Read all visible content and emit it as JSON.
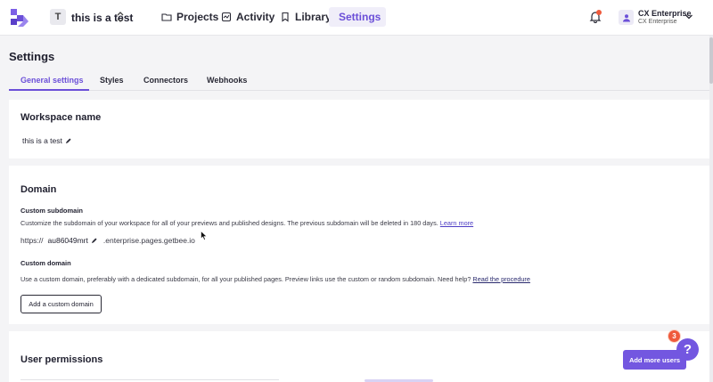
{
  "header": {
    "workspace_initial": "T",
    "workspace_name": "this is a test",
    "nav": [
      {
        "label": "Projects",
        "icon": "folder-icon"
      },
      {
        "label": "Activity",
        "icon": "activity-icon"
      },
      {
        "label": "Library",
        "icon": "bookmark-icon"
      },
      {
        "label": "Settings",
        "icon": "gear-icon",
        "active": true
      }
    ],
    "user": {
      "name": "CX Enterprise",
      "subtitle": "CX Enterprise"
    }
  },
  "page": {
    "title": "Settings",
    "tabs": [
      {
        "label": "General settings",
        "active": true
      },
      {
        "label": "Styles"
      },
      {
        "label": "Connectors"
      },
      {
        "label": "Webhooks"
      }
    ]
  },
  "workspace_section": {
    "title": "Workspace name",
    "value": "this is a test"
  },
  "domain_section": {
    "title": "Domain",
    "custom_subdomain": {
      "title": "Custom subdomain",
      "description": "Customize the subdomain of your workspace for all of your previews and published designs. The previous subdomain will be deleted in 180 days.",
      "link": "Learn more",
      "prefix": "https://",
      "subdomain": "au86049mrt",
      "suffix": ".enterprise.pages.getbee.io"
    },
    "custom_domain": {
      "title": "Custom domain",
      "description": "Use a custom domain, preferably with a dedicated subdomain, for all your published pages. Preview links use the custom or random subdomain. Need help?",
      "link": "Read the procedure",
      "button": "Add a custom domain"
    }
  },
  "permissions_section": {
    "title": "User permissions",
    "button": "Add more users"
  },
  "help": {
    "label": "?",
    "badge_count": "3"
  },
  "colors": {
    "accent": "#7357e0",
    "notification": "#ef5a3c"
  }
}
